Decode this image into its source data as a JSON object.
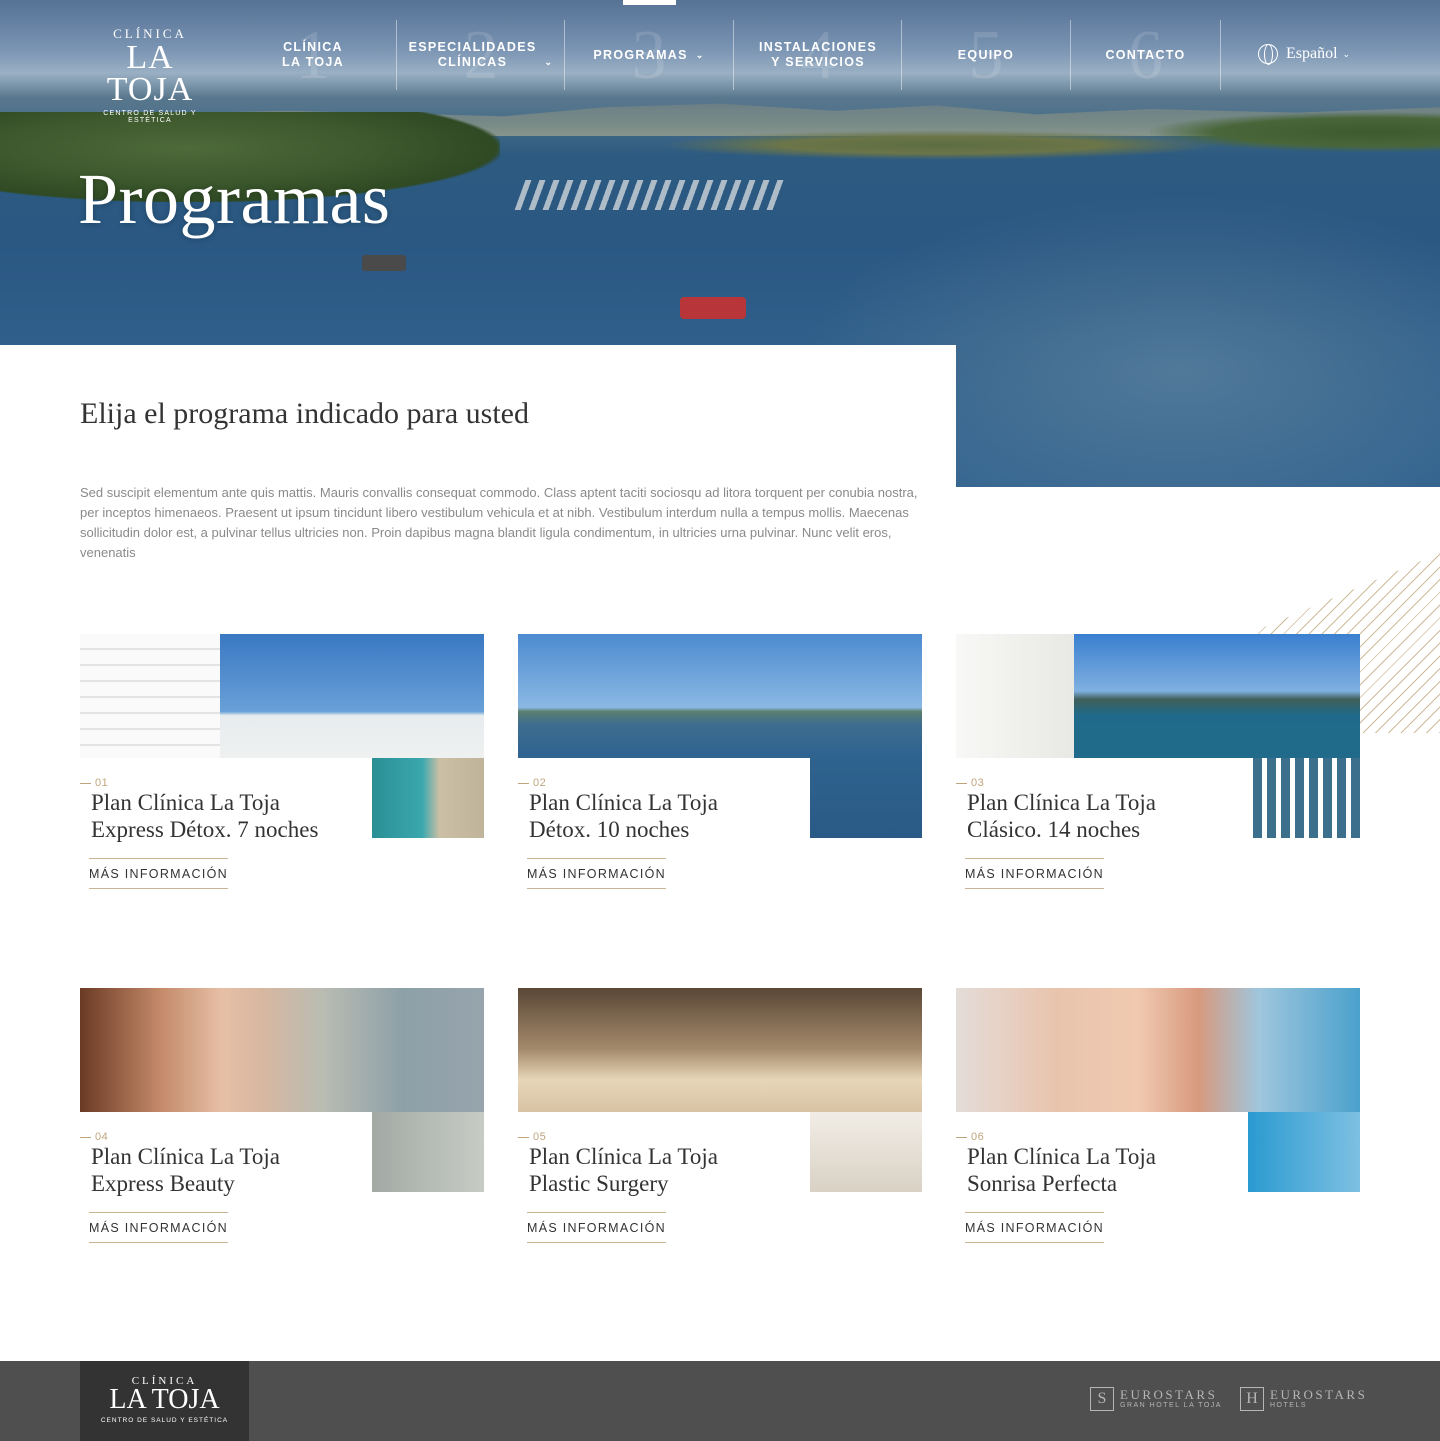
{
  "brand": {
    "top": "CLÍNICA",
    "name": "LA TOJA",
    "tagline": "CENTRO DE SALUD Y ESTÉTICA"
  },
  "nav": {
    "items": [
      {
        "num": "1",
        "label": "CLÍNICA\nLA TOJA",
        "has_dropdown": false
      },
      {
        "num": "2",
        "label": "ESPECIALIDADES\nCLÍNICAS",
        "has_dropdown": true
      },
      {
        "num": "3",
        "label": "PROGRAMAS",
        "has_dropdown": true,
        "active": true
      },
      {
        "num": "4",
        "label": "INSTALACIONES\nY SERVICIOS",
        "has_dropdown": false
      },
      {
        "num": "5",
        "label": "EQUIPO",
        "has_dropdown": false
      },
      {
        "num": "6",
        "label": "CONTACTO",
        "has_dropdown": false
      }
    ],
    "language": "Español"
  },
  "hero": {
    "title": "Programas"
  },
  "intro": {
    "title": "Elija el programa indicado para usted",
    "text": "Sed suscipit elementum ante quis mattis. Mauris convallis consequat commodo. Class aptent taciti sociosqu ad litora torquent per conubia nostra, per inceptos himenaeos. Praesent ut ipsum tincidunt libero vestibulum vehicula et at nibh. Vestibulum interdum nulla a tempus mollis. Maecenas sollicitudin dolor est, a pulvinar tellus ultricies non. Proin dapibus magna blandit ligula condimentum, in ultricies urna pulvinar. Nunc velit eros, venenatis"
  },
  "programs": [
    {
      "num": "01",
      "title_line1": "Plan Clínica La Toja",
      "title_line2": "Express Détox. 7 noches",
      "cta": "MÁS INFORMACIÓN",
      "image": "hotel-facade"
    },
    {
      "num": "02",
      "title_line1": "Plan Clínica La Toja",
      "title_line2": "Détox. 10 noches",
      "cta": "MÁS INFORMACIÓN",
      "image": "bay-view"
    },
    {
      "num": "03",
      "title_line1": "Plan Clínica La Toja",
      "title_line2": "Clásico. 14 noches",
      "cta": "MÁS INFORMACIÓN",
      "image": "terrace-sea"
    },
    {
      "num": "04",
      "title_line1": "Plan Clínica La Toja",
      "title_line2": "Express Beauty",
      "cta": "MÁS INFORMACIÓN",
      "image": "woman-portrait"
    },
    {
      "num": "05",
      "title_line1": "Plan Clínica La Toja",
      "title_line2": "Plastic Surgery",
      "cta": "MÁS INFORMACIÓN",
      "image": "massage"
    },
    {
      "num": "06",
      "title_line1": "Plan Clínica La Toja",
      "title_line2": "Sonrisa Perfecta",
      "cta": "MÁS INFORMACIÓN",
      "image": "dental-smile"
    }
  ],
  "footer": {
    "partners": [
      {
        "mark": "S",
        "name": "EUROSTARS",
        "sub": "GRAN HOTEL LA TOJA"
      },
      {
        "mark": "H",
        "name": "EUROSTARS",
        "sub": "HOTELS"
      }
    ]
  },
  "colors": {
    "accent_gold": "#c0a57c",
    "footer_bg": "#4f4f4f",
    "footer_logo_bg": "#333333",
    "text_dark": "#333333",
    "text_muted": "#8a8a8a"
  }
}
